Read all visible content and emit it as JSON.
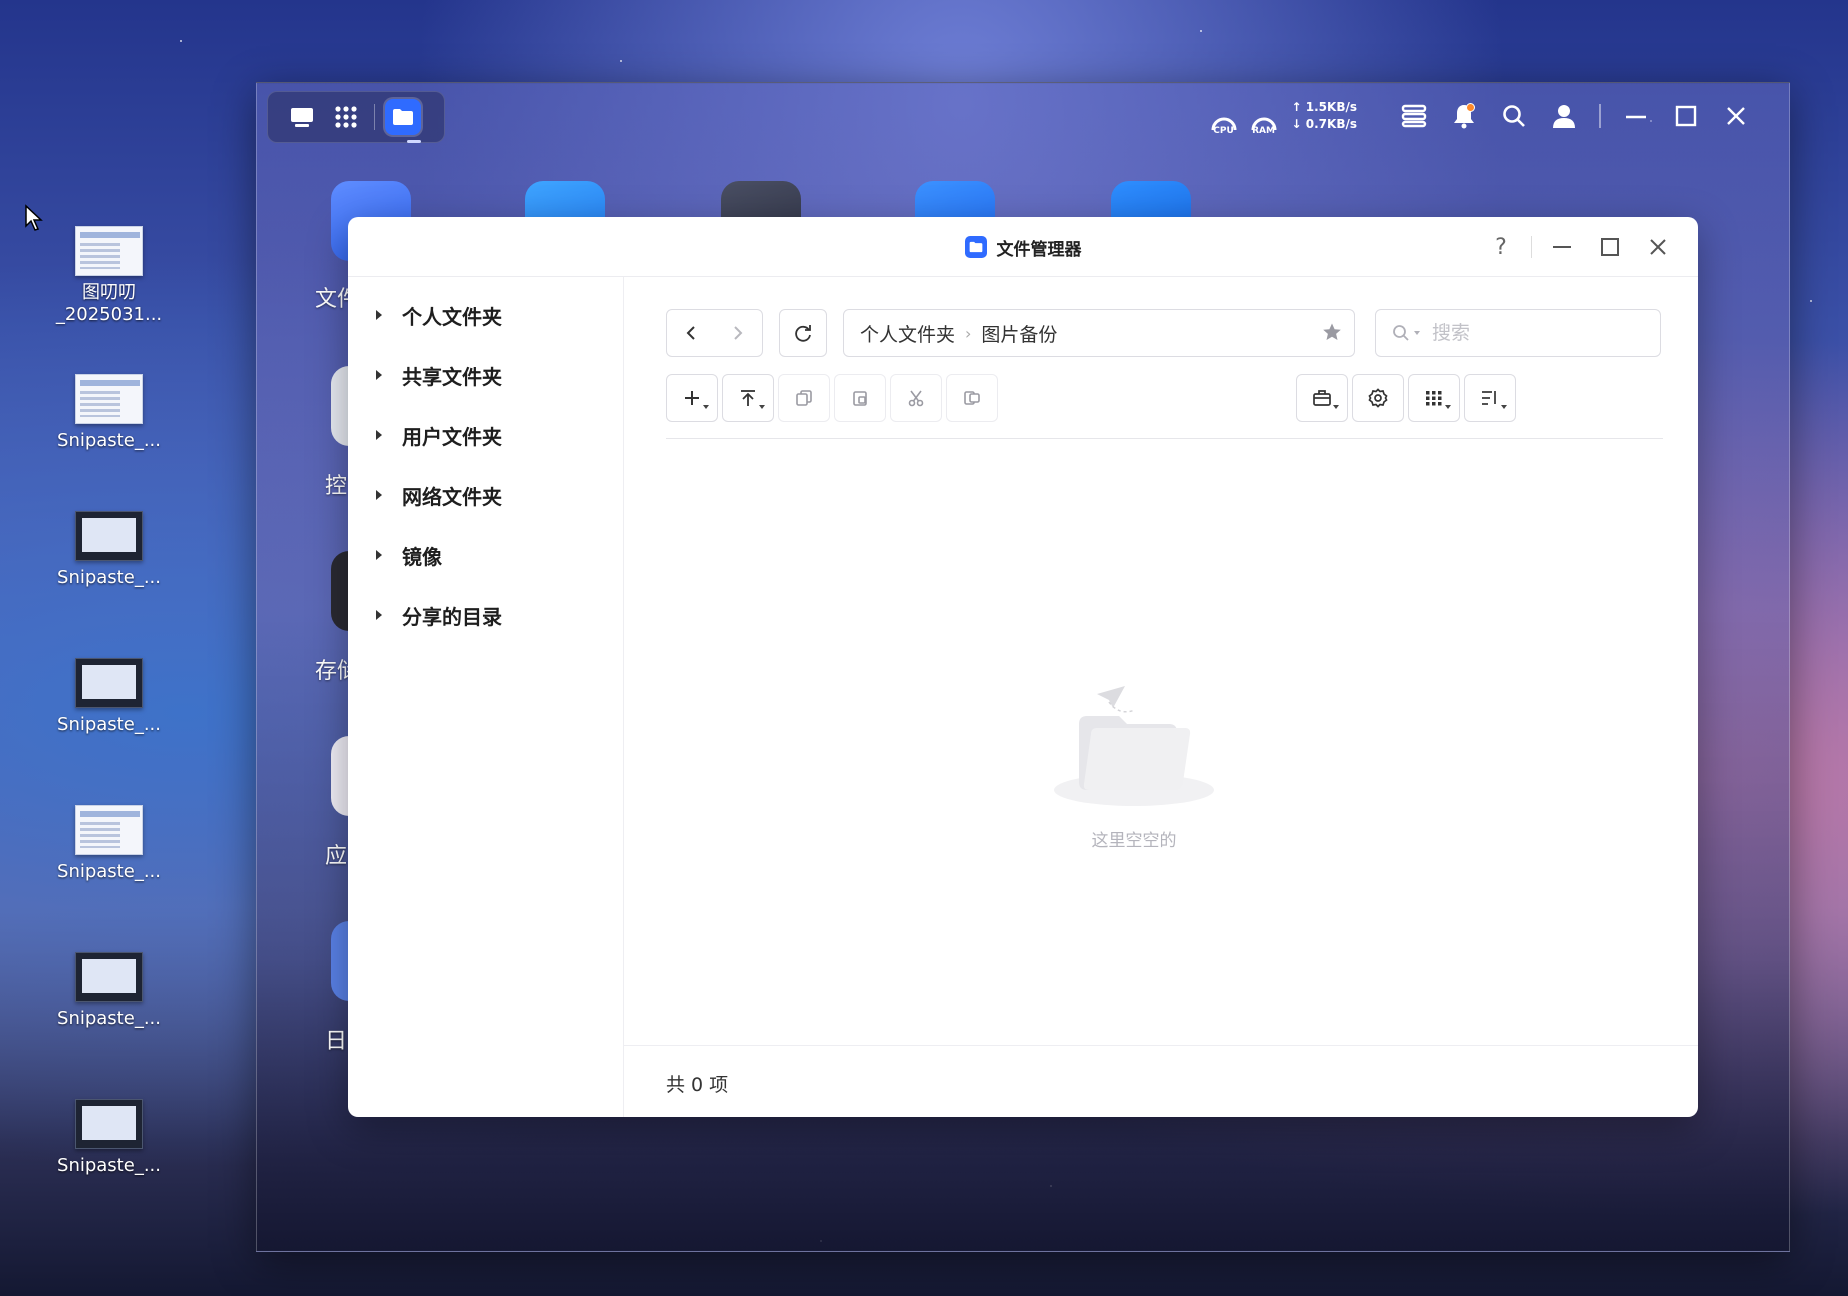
{
  "desktop": {
    "icons": [
      {
        "line1": "图叨叨",
        "line2": "_2025031..."
      },
      {
        "line1": "Snipaste_...",
        "line2": ""
      },
      {
        "line1": "Snipaste_...",
        "line2": ""
      },
      {
        "line1": "Snipaste_...",
        "line2": ""
      },
      {
        "line1": "Snipaste_...",
        "line2": ""
      },
      {
        "line1": "Snipaste_...",
        "line2": ""
      },
      {
        "line1": "Snipaste_...",
        "line2": ""
      }
    ]
  },
  "nas": {
    "topbar": {
      "cpu_label": "CPU",
      "ram_label": "RAM",
      "net_up": "↑ 1.5KB/s",
      "net_down": "↓ 0.7KB/s"
    },
    "apps": [
      {
        "label": "文件",
        "color": "#3a6cf6"
      },
      {
        "label": "控",
        "color": "#e9ecf4"
      },
      {
        "label": "存储",
        "color": "#2a2a33"
      },
      {
        "label": "应",
        "color": "#f1eff8"
      },
      {
        "label": "日",
        "color": "#5a82e8"
      }
    ]
  },
  "file_manager": {
    "title": "文件管理器",
    "help": "?",
    "sidebar": [
      "个人文件夹",
      "共享文件夹",
      "用户文件夹",
      "网络文件夹",
      "镜像",
      "分享的目录"
    ],
    "breadcrumb": [
      "个人文件夹",
      "图片备份"
    ],
    "search_placeholder": "搜索",
    "empty_text": "这里空空的",
    "status": "共 0 项"
  }
}
